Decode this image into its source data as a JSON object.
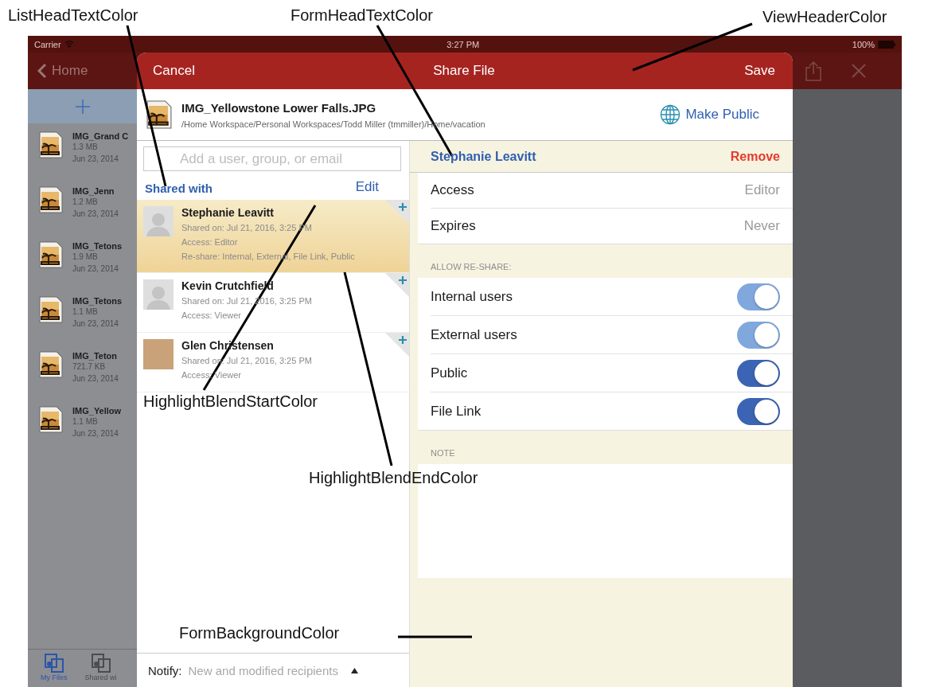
{
  "status_bar": {
    "carrier": "Carrier",
    "time": "3:27 PM",
    "battery": "100%"
  },
  "background_app": {
    "back_label": "Home",
    "files": [
      {
        "name": "IMG_Grand C",
        "size": "1.3 MB",
        "date": "Jun 23, 2014"
      },
      {
        "name": "IMG_Jenn",
        "size": "1.2 MB",
        "date": "Jun 23, 2014"
      },
      {
        "name": "IMG_Tetons",
        "size": "1.9 MB",
        "date": "Jun 23, 2014"
      },
      {
        "name": "IMG_Tetons",
        "size": "1.1 MB",
        "date": "Jun 23, 2014"
      },
      {
        "name": "IMG_Teton",
        "size": "721.7 KB",
        "date": "Jun 23, 2014"
      },
      {
        "name": "IMG_Yellow",
        "size": "1.1 MB",
        "date": "Jun 23, 2014"
      }
    ],
    "tabs": [
      {
        "label": "My Files",
        "selected": true
      },
      {
        "label": "Shared wi",
        "selected": false
      }
    ]
  },
  "dialog": {
    "cancel": "Cancel",
    "title": "Share File",
    "save": "Save",
    "file": {
      "name": "IMG_Yellowstone Lower Falls.JPG",
      "path": "/Home Workspace/Personal Workspaces/Todd Miller (tmmiller)/Home/vacation",
      "make_public": "Make Public"
    },
    "search": {
      "placeholder": "Add a user, group, or email"
    },
    "shared_with": {
      "heading": "Shared with",
      "edit": "Edit",
      "users": [
        {
          "name": "Stephanie Leavitt",
          "kind": "silhouette",
          "details": [
            "Shared on: Jul 21, 2016, 3:25 PM",
            "Access: Editor",
            "Re-share: Internal, External, File Link, Public"
          ],
          "selected": true
        },
        {
          "name": "Kevin Crutchfield",
          "kind": "silhouette",
          "details": [
            "Shared on: Jul 21, 2016, 3:25 PM",
            "Access: Viewer"
          ],
          "selected": false
        },
        {
          "name": "Glen Christensen",
          "kind": "photo",
          "details": [
            "Shared on: Jul 21, 2016, 3:25 PM",
            "Access: Viewer"
          ],
          "selected": false
        }
      ]
    },
    "notify": {
      "label": "Notify:",
      "value": "New and modified recipients"
    },
    "detail": {
      "name": "Stephanie Leavitt",
      "remove": "Remove",
      "fields": [
        {
          "label": "Access",
          "value": "Editor"
        },
        {
          "label": "Expires",
          "value": "Never"
        }
      ],
      "reshare_heading": "ALLOW RE-SHARE:",
      "reshare": [
        {
          "label": "Internal users",
          "on": true,
          "disabled": true
        },
        {
          "label": "External users",
          "on": true,
          "disabled": true
        },
        {
          "label": "Public",
          "on": true,
          "disabled": false
        },
        {
          "label": "File Link",
          "on": true,
          "disabled": false
        }
      ],
      "note_heading": "NOTE"
    }
  },
  "annotations": [
    {
      "text": "ListHeadTextColor"
    },
    {
      "text": "FormHeadTextColor"
    },
    {
      "text": "ViewHeaderColor"
    },
    {
      "text": "HighlightBlendStartColor"
    },
    {
      "text": "HighlightBlendEndColor"
    },
    {
      "text": "FormBackgroundColor"
    }
  ]
}
